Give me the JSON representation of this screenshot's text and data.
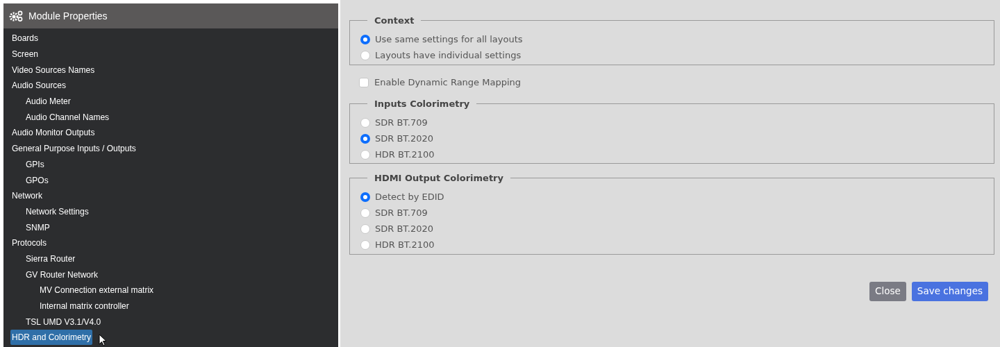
{
  "sidebar": {
    "title": "Module Properties",
    "items": [
      {
        "label": "Boards",
        "selected": false
      },
      {
        "label": "Screen",
        "selected": false
      },
      {
        "label": "Video Sources Names",
        "selected": false
      },
      {
        "label": "Audio Sources",
        "selected": false,
        "children": [
          {
            "label": "Audio Meter",
            "selected": false
          },
          {
            "label": "Audio Channel Names",
            "selected": false
          }
        ]
      },
      {
        "label": "Audio Monitor Outputs",
        "selected": false
      },
      {
        "label": "General Purpose Inputs / Outputs",
        "selected": false,
        "children": [
          {
            "label": "GPIs",
            "selected": false
          },
          {
            "label": "GPOs",
            "selected": false
          }
        ]
      },
      {
        "label": "Network",
        "selected": false,
        "children": [
          {
            "label": "Network Settings",
            "selected": false
          },
          {
            "label": "SNMP",
            "selected": false
          }
        ]
      },
      {
        "label": "Protocols",
        "selected": false,
        "children": [
          {
            "label": "Sierra Router",
            "selected": false
          },
          {
            "label": "GV Router Network",
            "selected": false,
            "children": [
              {
                "label": "MV Connection external matrix",
                "selected": false
              },
              {
                "label": "Internal matrix controller",
                "selected": false
              }
            ]
          },
          {
            "label": "TSL UMD V3.1/V4.0",
            "selected": false
          }
        ]
      },
      {
        "label": "HDR and Colorimetry",
        "selected": true
      }
    ]
  },
  "form": [
    {
      "kind": "group",
      "legend": "Context",
      "options": [
        {
          "label": "Use same settings for all layouts",
          "selected": true
        },
        {
          "label": "Layouts have individual settings",
          "selected": false
        }
      ]
    },
    {
      "kind": "checkbox",
      "label": "Enable Dynamic Range Mapping",
      "checked": false
    },
    {
      "kind": "group",
      "legend": "Inputs Colorimetry",
      "options": [
        {
          "label": "SDR BT.709",
          "selected": false
        },
        {
          "label": "SDR BT.2020",
          "selected": true
        },
        {
          "label": "HDR BT.2100",
          "selected": false
        }
      ]
    },
    {
      "kind": "group",
      "legend": "HDMI Output Colorimetry",
      "options": [
        {
          "label": "Detect by EDID",
          "selected": true
        },
        {
          "label": "SDR BT.709",
          "selected": false
        },
        {
          "label": "SDR BT.2020",
          "selected": false
        },
        {
          "label": "HDR BT.2100",
          "selected": false
        }
      ]
    }
  ],
  "buttons": [
    {
      "label": "Close",
      "kind": "secondary"
    },
    {
      "label": "Save changes",
      "kind": "primary"
    }
  ]
}
